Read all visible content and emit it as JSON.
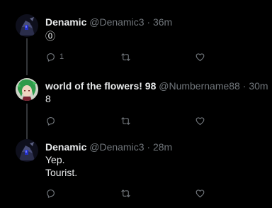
{
  "tweets": [
    {
      "display_name": "Denamic",
      "handle": "@Denamic3",
      "separator": "·",
      "time": "36m",
      "lines": [
        "⓪"
      ],
      "reply_count": "1"
    },
    {
      "display_name": "world of the flowers! 98",
      "handle": "@Numbername88",
      "separator": "·",
      "time": "30m",
      "lines": [
        "8"
      ],
      "reply_count": ""
    },
    {
      "display_name": "Denamic",
      "handle": "@Denamic3",
      "separator": "·",
      "time": "28m",
      "lines": [
        "Yep.",
        "Tourist."
      ],
      "reply_count": ""
    }
  ],
  "icons": {
    "reply": "reply-icon",
    "retweet": "retweet-icon",
    "like": "heart-icon"
  },
  "colors": {
    "background": "#000000",
    "primary_text": "#e7e9ea",
    "secondary_text": "#71767b",
    "thread_line": "#333639"
  }
}
